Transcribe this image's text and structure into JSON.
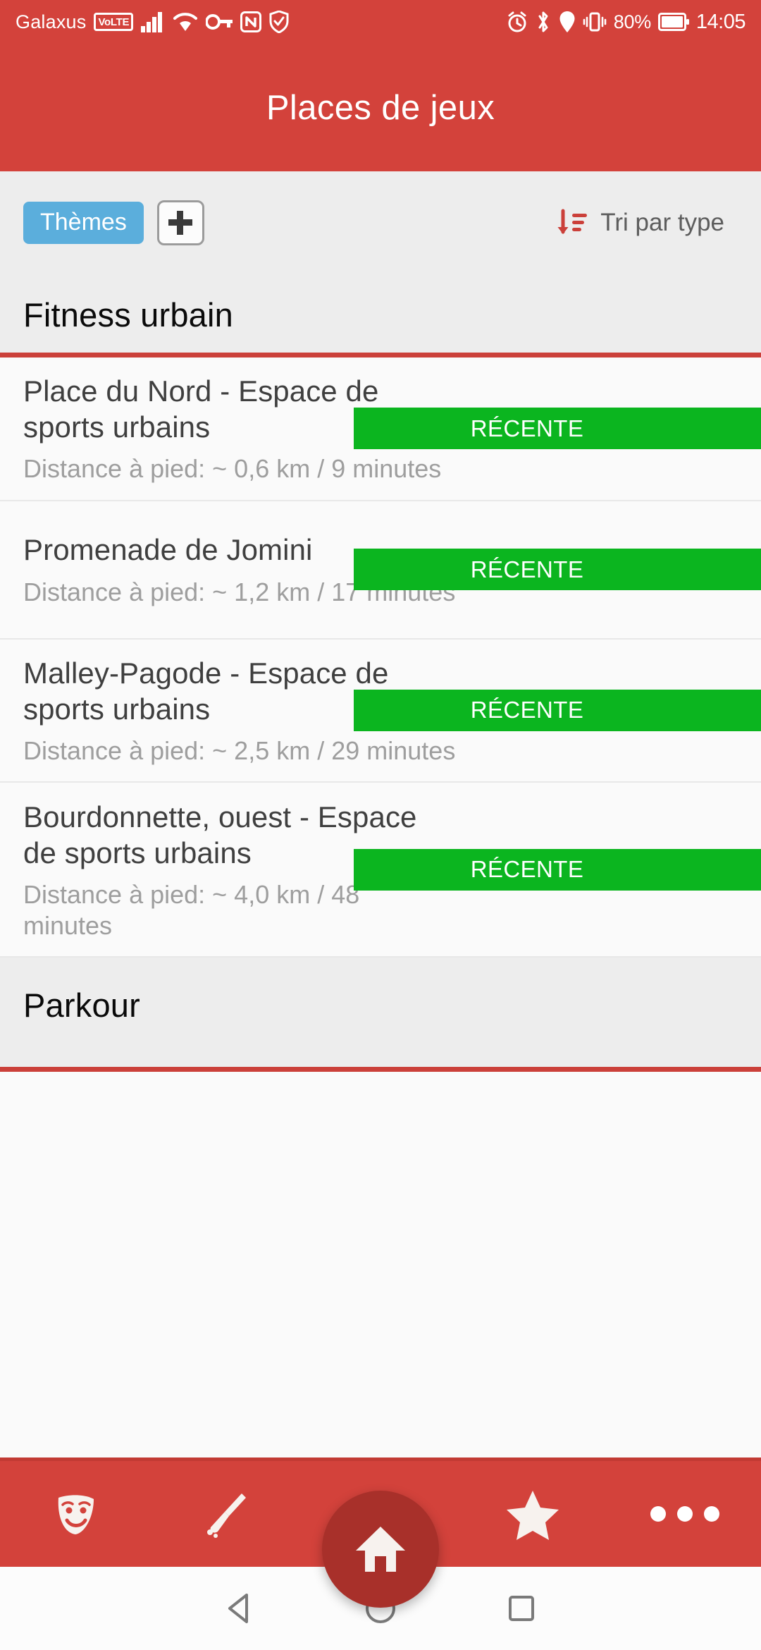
{
  "status_bar": {
    "carrier": "Galaxus",
    "volte_badge": "VoLTE",
    "battery_percent": "80%",
    "clock": "14:05",
    "left_icons": [
      "signal-bars-icon",
      "wifi-icon",
      "vpn-key-icon",
      "nfc-icon",
      "shield-icon"
    ],
    "right_icons": [
      "alarm-icon",
      "bluetooth-icon",
      "location-icon",
      "vibrate-icon",
      "battery-icon"
    ]
  },
  "app_bar": {
    "title": "Places de jeux",
    "background_color": "#D3423B"
  },
  "filter_bar": {
    "theme_chip_label": "Thèmes",
    "theme_chip_color": "#5BAEDC",
    "add_chip_icon": "plus-icon",
    "sort_icon": "sort-descending-icon",
    "sort_icon_color": "#CB403A",
    "sort_label": "Tri par type"
  },
  "sections": [
    {
      "title": "Fitness urbain",
      "items": [
        {
          "title": "Place du Nord - Espace de sports urbains",
          "subtitle": "Distance à pied: ~ 0,6 km / 9 minutes",
          "badge": "RÉCENTE"
        },
        {
          "title": "Promenade de Jomini",
          "subtitle": "Distance à pied: ~ 1,2 km / 17 minutes",
          "badge": "RÉCENTE"
        },
        {
          "title": "Malley-Pagode - Espace de sports urbains",
          "subtitle": "Distance à pied: ~ 2,5 km / 29 minutes",
          "badge": "RÉCENTE"
        },
        {
          "title": "Bourdonnette, ouest - Espace de sports urbains",
          "subtitle": "Distance à pied: ~ 4,0 km / 48 minutes",
          "badge": "RÉCENTE"
        }
      ]
    },
    {
      "title": "Parkour",
      "items": []
    }
  ],
  "badge_color": "#0BB51F",
  "bottom_nav": {
    "items": [
      {
        "icon": "theater-mask-icon",
        "name": "nav-theater"
      },
      {
        "icon": "broom-icon",
        "name": "nav-broom"
      },
      {
        "icon": "star-icon",
        "name": "nav-star"
      },
      {
        "icon": "more-dots-icon",
        "name": "nav-more"
      }
    ],
    "fab_icon": "home-icon",
    "fab_color": "#A8302A"
  },
  "system_nav": {
    "back": "back-triangle-icon",
    "home": "home-circle-icon",
    "recents": "recents-square-icon"
  }
}
